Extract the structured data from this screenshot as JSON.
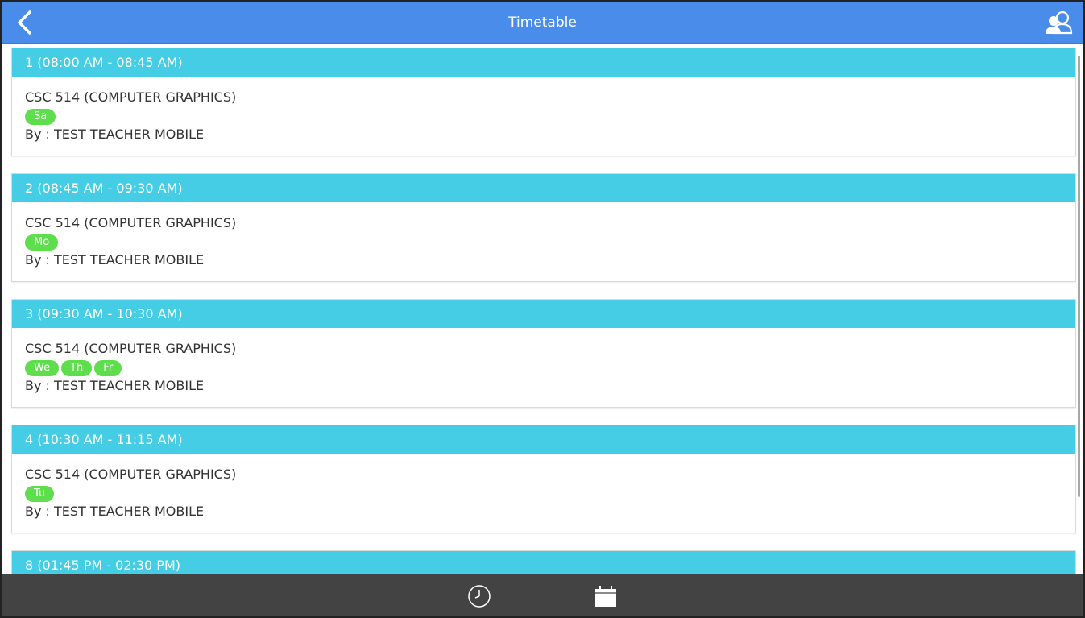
{
  "header": {
    "title": "Timetable",
    "back_icon": "chevron-left-icon",
    "profile_icon": "users-icon",
    "color": "#4a8cea"
  },
  "periods": [
    {
      "label": "1 (08:00 AM - 08:45 AM)",
      "course": "CSC 514 (COMPUTER GRAPHICS)",
      "days": [
        "Sa"
      ],
      "teacher": "By : TEST TEACHER MOBILE"
    },
    {
      "label": "2 (08:45 AM - 09:30 AM)",
      "course": "CSC 514 (COMPUTER GRAPHICS)",
      "days": [
        "Mo"
      ],
      "teacher": "By : TEST TEACHER MOBILE"
    },
    {
      "label": "3 (09:30 AM - 10:30 AM)",
      "course": "CSC 514 (COMPUTER GRAPHICS)",
      "days": [
        "We",
        "Th",
        "Fr"
      ],
      "teacher": "By : TEST TEACHER MOBILE"
    },
    {
      "label": "4 (10:30 AM - 11:15 AM)",
      "course": "CSC 514 (COMPUTER GRAPHICS)",
      "days": [
        "Tu"
      ],
      "teacher": "By : TEST TEACHER MOBILE"
    },
    {
      "label": "8 (01:45 PM - 02:30 PM)"
    }
  ],
  "footer": {
    "tabs": [
      {
        "icon": "clock-icon"
      },
      {
        "icon": "calendar-icon"
      }
    ],
    "color": "#434343"
  },
  "colors": {
    "period_header": "#44cde4",
    "day_badge": "#5fde4d"
  }
}
